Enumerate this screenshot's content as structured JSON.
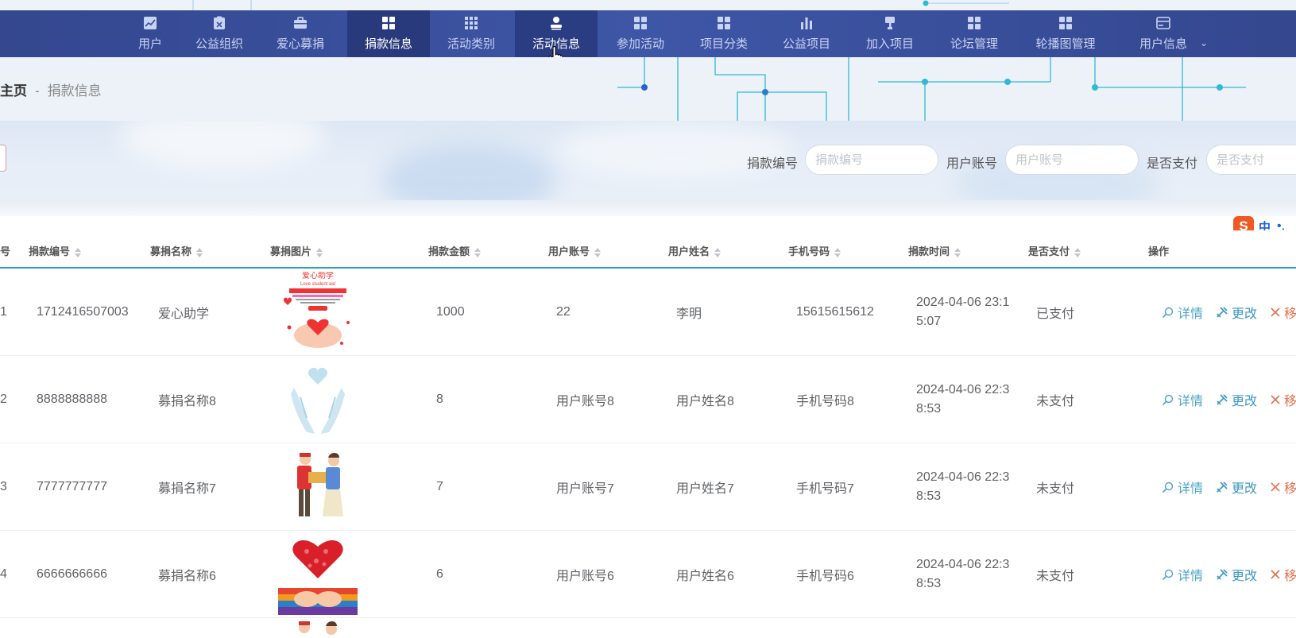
{
  "nav": {
    "items": [
      {
        "label": "用户",
        "icon": "chart-icon"
      },
      {
        "label": "公益组织",
        "icon": "clipboard-icon"
      },
      {
        "label": "爱心募捐",
        "icon": "briefcase-icon"
      },
      {
        "label": "捐款信息",
        "icon": "grid-icon"
      },
      {
        "label": "活动类别",
        "icon": "grid-nine-icon"
      },
      {
        "label": "活动信息",
        "icon": "person-icon"
      },
      {
        "label": "参加活动",
        "icon": "grid-icon"
      },
      {
        "label": "项目分类",
        "icon": "grid-icon"
      },
      {
        "label": "公益项目",
        "icon": "bar-chart-icon"
      },
      {
        "label": "加入项目",
        "icon": "stamp-icon"
      },
      {
        "label": "论坛管理",
        "icon": "grid-icon"
      },
      {
        "label": "轮播图管理",
        "icon": "grid-icon"
      },
      {
        "label": "用户信息",
        "icon": "wallet-icon"
      }
    ],
    "active_index": 3,
    "hover_index": 5
  },
  "breadcrumb": {
    "home": "主页",
    "separator": "-",
    "current": "捐款信息"
  },
  "search": {
    "fields": [
      {
        "label": "捐款编号",
        "placeholder": "捐款编号"
      },
      {
        "label": "用户账号",
        "placeholder": "用户账号"
      },
      {
        "label": "是否支付",
        "placeholder": "是否支付"
      }
    ]
  },
  "ime": {
    "logo": "S",
    "mode": "中",
    "punct": "•,"
  },
  "table": {
    "headers": [
      "号",
      "捐款编号",
      "募捐名称",
      "募捐图片",
      "捐款金额",
      "用户账号",
      "用户姓名",
      "手机号码",
      "捐款时间",
      "是否支付",
      "操作"
    ],
    "rows": [
      {
        "idx": "1",
        "code": "1712416507003",
        "name": "爱心助学",
        "amount": "1000",
        "account": "22",
        "username": "李明",
        "phone": "15615615612",
        "time": "2024-04-06 23:15:07",
        "paid": "已支付",
        "image": "student-aid-poster"
      },
      {
        "idx": "2",
        "code": "8888888888",
        "name": "募捐名称8",
        "amount": "8",
        "account": "用户账号8",
        "username": "用户姓名8",
        "phone": "手机号码8",
        "time": "2024-04-06 22:38:53",
        "paid": "未支付",
        "image": "heart-hands"
      },
      {
        "idx": "3",
        "code": "7777777777",
        "name": "募捐名称7",
        "amount": "7",
        "account": "用户账号7",
        "username": "用户姓名7",
        "phone": "手机号码7",
        "time": "2024-04-06 22:38:53",
        "paid": "未支付",
        "image": "volunteers-box"
      },
      {
        "idx": "4",
        "code": "6666666666",
        "name": "募捐名称6",
        "amount": "6",
        "account": "用户账号6",
        "username": "用户姓名6",
        "phone": "手机号码6",
        "time": "2024-04-06 22:38:53",
        "paid": "未支付",
        "image": "red-heart-hands"
      }
    ],
    "actions": {
      "detail": "详情",
      "edit": "更改",
      "delete": "移"
    }
  },
  "colors": {
    "nav_bg": "#3e56a6",
    "nav_active": "#283a7c",
    "accent": "#2a9fd0",
    "delete": "#e5704f"
  }
}
